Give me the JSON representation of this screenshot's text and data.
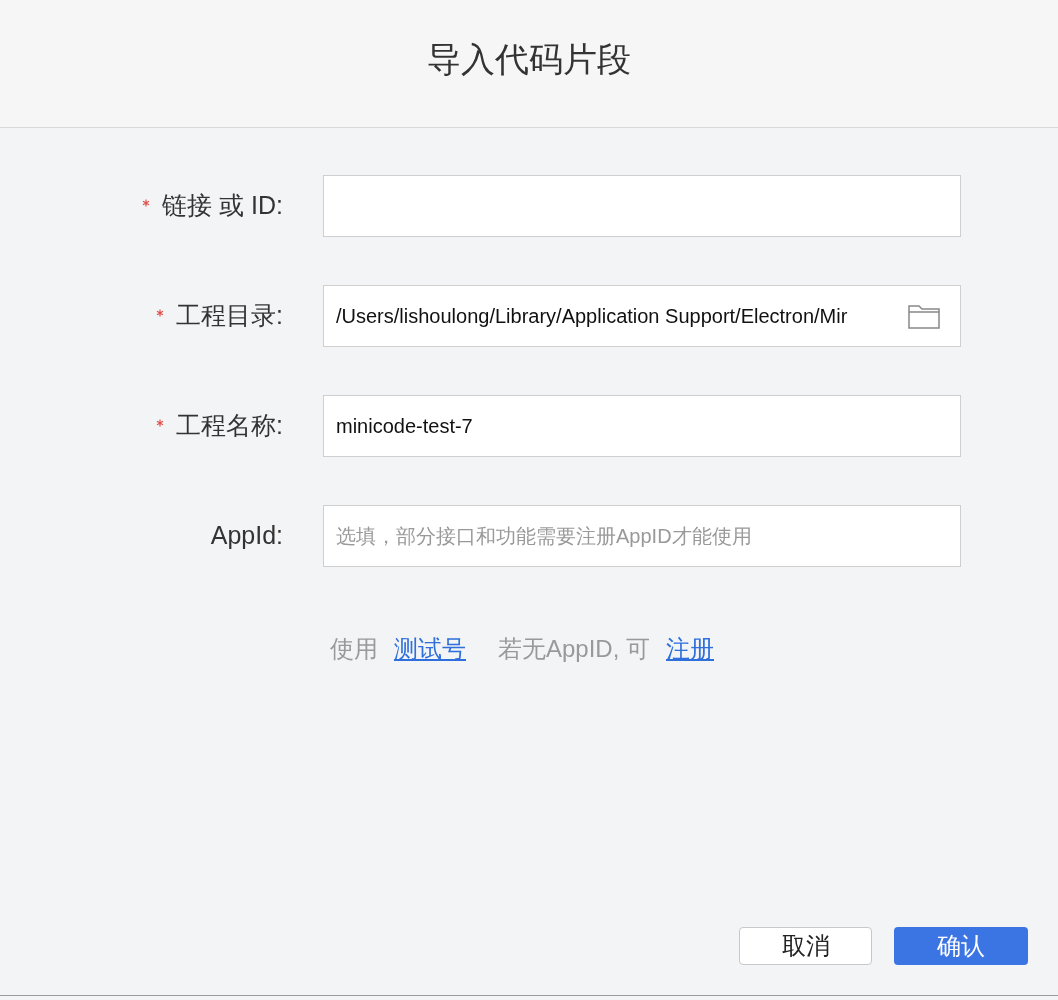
{
  "dialog": {
    "title": "导入代码片段"
  },
  "fields": [
    {
      "kind": "text",
      "label": "链接 或 ID:",
      "required": true
    },
    {
      "kind": "folder",
      "label": "工程目录:",
      "required": true,
      "value": "/Users/lishoulong/Library/Application Support/Electron/Mir"
    },
    {
      "kind": "text",
      "label": "工程名称:",
      "required": true,
      "value": "minicode-test-7"
    },
    {
      "kind": "text",
      "label": "AppId:",
      "required": false,
      "placeholder": "选填，部分接口和功能需要注册AppID才能使用"
    }
  ],
  "hint": {
    "prefix": "使用",
    "link_1": "测试号",
    "middle": "若无AppID, 可",
    "link_2": "注册"
  },
  "buttons": [
    {
      "label": "取消",
      "kind": "secondary"
    },
    {
      "label": "确认",
      "kind": "primary"
    }
  ]
}
